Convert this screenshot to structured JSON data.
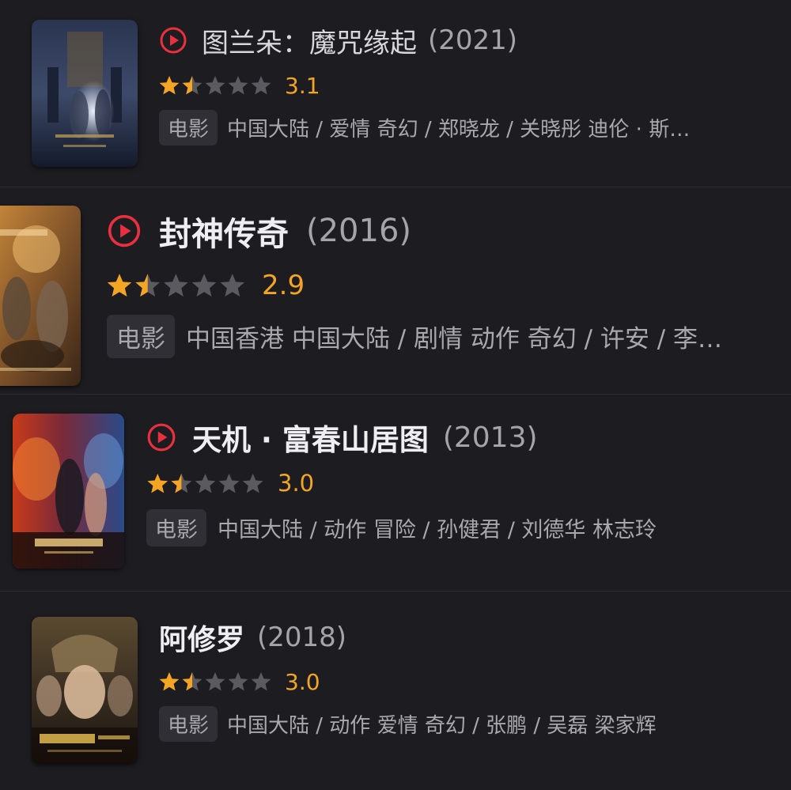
{
  "colors": {
    "background": "#1d1d21",
    "title": "#efeff1",
    "muted_text": "#a8a8ae",
    "rating": "#f5a524",
    "star_empty": "#5a5a60",
    "play_icon": "#e8303f",
    "tag_background": "#2f2f35"
  },
  "movies": [
    {
      "title": "图兰朵：魔咒缘起",
      "year": "(2021)",
      "playable": true,
      "rating_stars": 1.5,
      "score": "3.1",
      "tag": "电影",
      "meta": "中国大陆 / 爱情 奇幻 / 郑晓龙 / 关晓彤 迪伦 · 斯…",
      "poster_icon": "poster-image"
    },
    {
      "title": "封神传奇",
      "year": "(2016)",
      "playable": true,
      "rating_stars": 1.5,
      "score": "2.9",
      "tag": "电影",
      "meta": "中国香港 中国大陆 / 剧情 动作 奇幻 / 许安 / 李…",
      "poster_icon": "poster-image"
    },
    {
      "title": "天机 · 富春山居图",
      "year": "(2013)",
      "playable": true,
      "rating_stars": 1.5,
      "score": "3.0",
      "tag": "电影",
      "meta": "中国大陆 / 动作 冒险 / 孙健君 / 刘德华 林志玲",
      "poster_icon": "poster-image"
    },
    {
      "title": "阿修罗",
      "year": "(2018)",
      "playable": false,
      "rating_stars": 1.5,
      "score": "3.0",
      "tag": "电影",
      "meta": "中国大陆 / 动作 爱情 奇幻 / 张鹏 / 吴磊 梁家辉",
      "poster_icon": "poster-image"
    }
  ]
}
